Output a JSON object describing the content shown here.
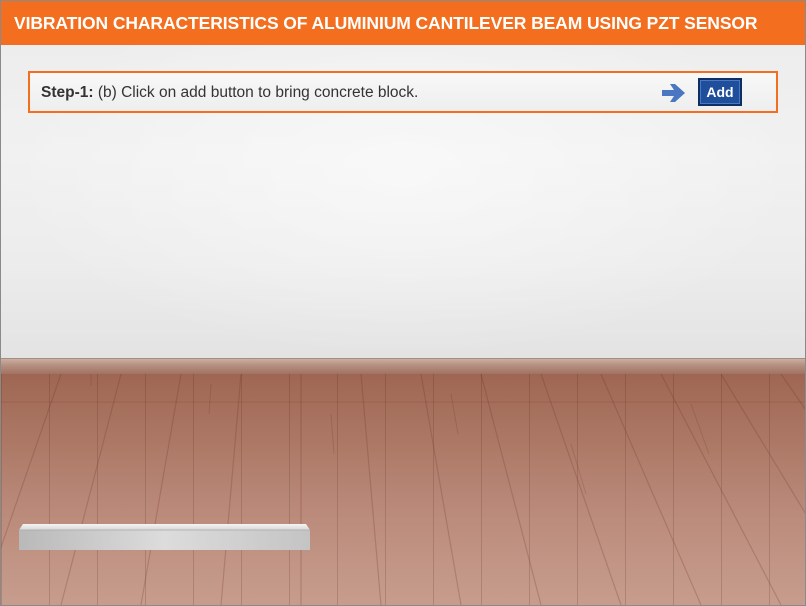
{
  "app": {
    "title": "VIBRATION CHARACTERISTICS OF ALUMINIUM CANTILEVER BEAM USING PZT SENSOR"
  },
  "instruction": {
    "step_label": "Step-1:",
    "text": " (b) Click on add button to bring concrete block."
  },
  "actions": {
    "add_label": "Add",
    "arrow_icon": "arrow-right-icon"
  },
  "scene": {
    "objects": [
      "concrete-block"
    ]
  },
  "colors": {
    "accent": "#f36f1f",
    "button": "#1f4e9a",
    "arrow": "#4a76c2"
  }
}
